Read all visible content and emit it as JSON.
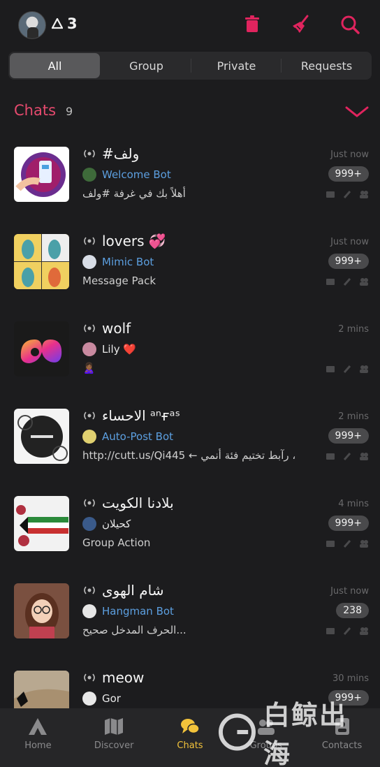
{
  "header": {
    "reputation": "3",
    "icons": [
      "trash-icon",
      "broom-icon",
      "search-icon"
    ],
    "accent": "#e0245e"
  },
  "tabs": [
    {
      "label": "All",
      "active": true
    },
    {
      "label": "Group",
      "active": false
    },
    {
      "label": "Private",
      "active": false
    },
    {
      "label": "Requests",
      "active": false
    }
  ],
  "section": {
    "title": "Chats",
    "count": "9"
  },
  "chats": [
    {
      "name": "#ولف",
      "time": "Just now",
      "sender": "Welcome Bot",
      "sender_type": "bot",
      "preview": "أهلاً بك في غرفة #ولف",
      "badge": "999+"
    },
    {
      "name": "lovers 💞",
      "time": "Just now",
      "sender": "Mimic Bot",
      "sender_type": "bot",
      "preview": "Message Pack",
      "badge": "999+"
    },
    {
      "name": "wolf",
      "time": "2 mins",
      "sender": "Lily ❤️",
      "sender_type": "user",
      "preview": "🙎🏾‍♀️",
      "badge": ""
    },
    {
      "name": "الاحساء ᵃⁿғᵃˢ",
      "time": "2 mins",
      "sender": "Auto-Post Bot",
      "sender_type": "bot",
      "preview": "http://cutt.us/Qi445 ← رآبط تختيم فئة أنمي ،",
      "badge": "999+"
    },
    {
      "name": "بلادنا الكويت",
      "time": "4 mins",
      "sender": "كحيلان",
      "sender_type": "user",
      "preview": "Group Action",
      "badge": "999+"
    },
    {
      "name": "شام الهوى",
      "time": "Just now",
      "sender": "Hangman Bot",
      "sender_type": "bot",
      "preview": "الحرف المدخل صحيح...",
      "badge": "238"
    },
    {
      "name": "meow",
      "time": "30 mins",
      "sender": "Gor",
      "sender_type": "user",
      "preview": "",
      "badge": "999+"
    }
  ],
  "bottom_nav": [
    {
      "label": "Home",
      "icon": "amino-logo-icon",
      "active": false
    },
    {
      "label": "Discover",
      "icon": "map-icon",
      "active": false
    },
    {
      "label": "Chats",
      "icon": "chat-bubbles-icon",
      "active": true
    },
    {
      "label": "Groups",
      "icon": "groups-icon",
      "active": false
    },
    {
      "label": "Contacts",
      "icon": "contacts-icon",
      "active": false
    }
  ],
  "watermark": {
    "text": "白鲸出海"
  }
}
